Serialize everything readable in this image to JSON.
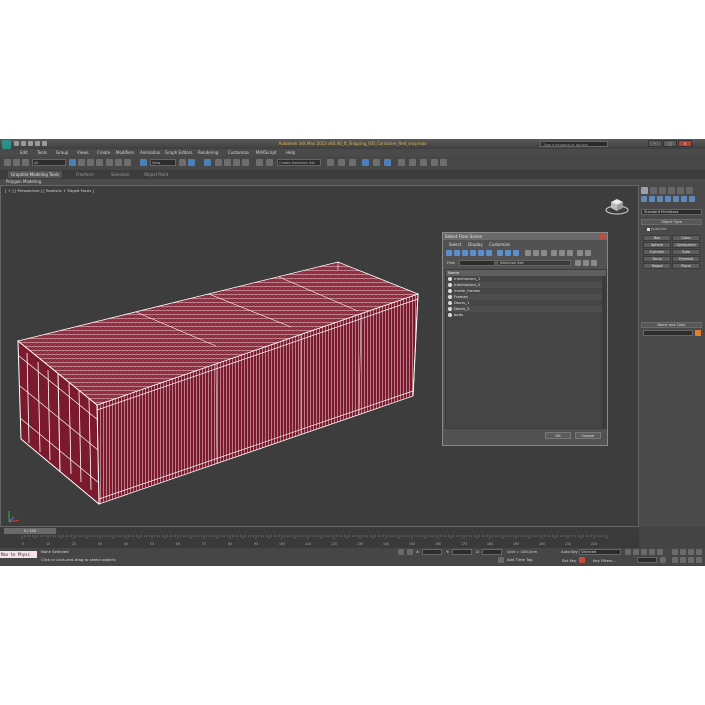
{
  "app": {
    "title": "Autodesk 3ds Max 2013 x64    40_ft_Shipping_ISO_Container_Red_vray.max",
    "search_placeholder": "Type a keyword or phrase",
    "window_buttons": [
      "–",
      "□",
      "✕"
    ]
  },
  "menu": [
    "Edit",
    "Tools",
    "Group",
    "Views",
    "Create",
    "Modifiers",
    "Animation",
    "Graph Editors",
    "Rendering",
    "Customize",
    "MAXScript",
    "Help"
  ],
  "toolbar": {
    "filter_dropdown": "All",
    "view_dropdown": "View",
    "selection_set_dropdown": "Create Selection Set"
  },
  "ribbon": {
    "tabs": [
      "Graphite Modeling Tools",
      "Freeform",
      "Selection",
      "Object Paint"
    ],
    "active_tab": "Graphite Modeling Tools",
    "panel_label": "Polygon Modeling"
  },
  "viewport": {
    "label": "[ + ] [ Perspective ] [ Realistic + Edged Faces ]"
  },
  "command_panel": {
    "category_dropdown": "Standard Primitives",
    "object_type_rollout": "Object Type",
    "autogrid_label": "AutoGrid",
    "primitives": [
      "Box",
      "Cone",
      "Sphere",
      "GeoSphere",
      "Cylinder",
      "Tube",
      "Torus",
      "Pyramid",
      "Teapot",
      "Plane"
    ],
    "name_color_rollout": "Name and Color"
  },
  "select_dialog": {
    "title": "Select From Scene",
    "menu": [
      "Select",
      "Display",
      "Customize"
    ],
    "find_label": "Find:",
    "selection_set_placeholder": "Selection Set:",
    "column_header": "Name",
    "items": [
      "mechanism_1",
      "mechanism_2",
      "inside_frames",
      "Frames",
      "Doors_1",
      "Doors_2",
      "bolts"
    ],
    "ok_label": "OK",
    "cancel_label": "Cancel"
  },
  "timeline": {
    "slider_label": "0 / 225",
    "ticks": [
      "0",
      "10",
      "20",
      "30",
      "40",
      "50",
      "60",
      "70",
      "80",
      "90",
      "100",
      "110",
      "120",
      "130",
      "140",
      "150",
      "160",
      "170",
      "180",
      "190",
      "200",
      "210",
      "220"
    ]
  },
  "status": {
    "maxscript_listener": "Max to Physc",
    "selection_status": "None Selected",
    "prompt": "Click or click-and-drag to select objects",
    "grid": "Grid = 100,0cm",
    "auto_key": "Auto Key",
    "auto_key_mode": "Selected",
    "set_key": "Set Key",
    "key_filters": "Key Filters...",
    "add_time_tag": "Add Time Tag"
  },
  "colors": {
    "container": "#7a1a2c",
    "wireframe": "#ffffff",
    "viewport_bg": "#3d3d3d",
    "title_accent": "#e3b84a"
  }
}
